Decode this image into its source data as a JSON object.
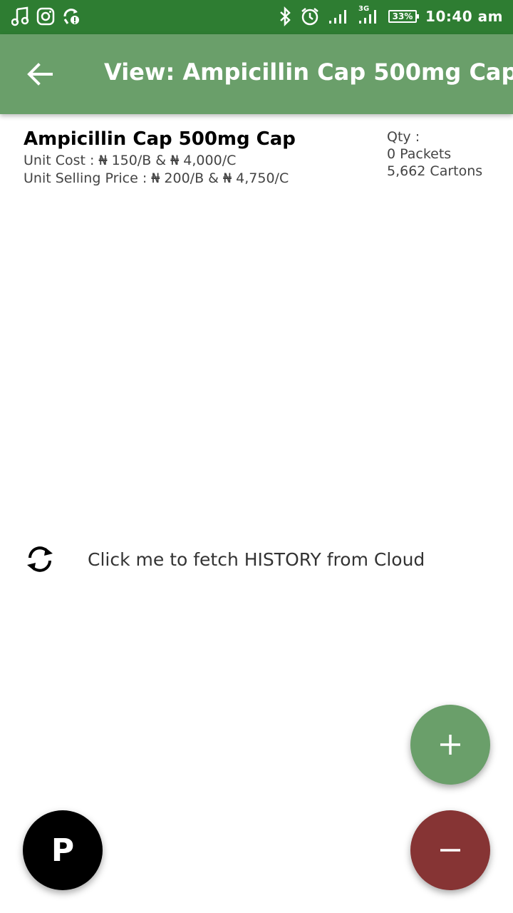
{
  "status_bar": {
    "network_type": "3G",
    "battery": "33%",
    "time": "10:40 am",
    "icons": [
      "music-icon",
      "instagram-icon",
      "sync-icon",
      "bluetooth-icon",
      "alarm-icon",
      "signal-icon"
    ]
  },
  "app_bar": {
    "title": "View: Ampicillin Cap 500mg Cap",
    "back_icon": "arrow-left-icon",
    "color": "#6a9f6a"
  },
  "product": {
    "name": "Ampicillin Cap 500mg Cap",
    "unit_cost_label": "Unit Cost : ",
    "unit_cost_b_symbol": "₦",
    "unit_cost_b_value": " 150/B & ",
    "unit_cost_c_symbol": "₦",
    "unit_cost_c_value": " 4,000/C",
    "selling_label": "Unit Selling Price : ",
    "selling_b_symbol": "₦",
    "selling_b_value": " 200/B & ",
    "selling_c_symbol": "₦",
    "selling_c_value": " 4,750/C"
  },
  "quantity": {
    "label": "Qty :",
    "packets": "0 Packets",
    "cartons": "5,662 Cartons"
  },
  "fetch": {
    "label": "Click me to fetch HISTORY from Cloud",
    "icon": "refresh-icon"
  },
  "fabs": {
    "add_icon": "plus-icon",
    "add_color": "#6a9f6a",
    "remove_icon": "minus-icon",
    "remove_color": "#863434",
    "p_label": "P"
  }
}
